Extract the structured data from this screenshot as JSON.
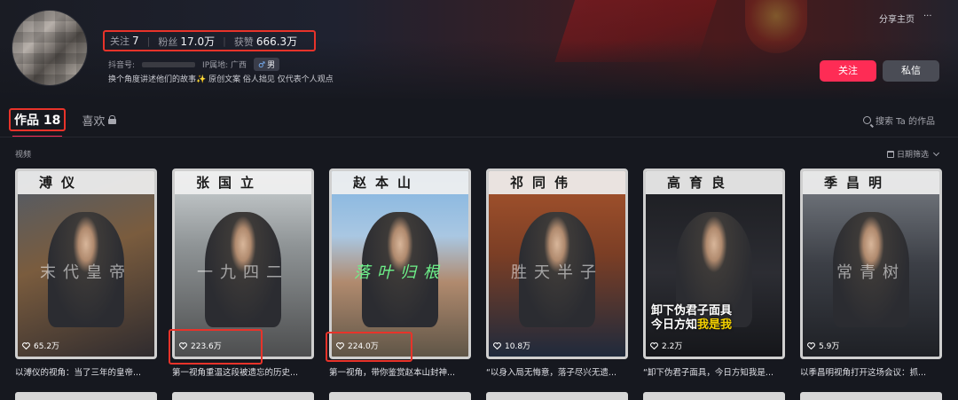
{
  "profile": {
    "username": "",
    "stats": {
      "following_label": "关注",
      "following_value": "7",
      "fans_label": "粉丝",
      "fans_value": "17.0万",
      "likes_label": "获赞",
      "likes_value": "666.3万"
    },
    "douyin_id_label": "抖音号:",
    "ip_label": "IP属地: 广西",
    "gender": "男",
    "bio": "换个角度讲述他们的故事✨ 原创文案 俗人拙见 仅代表个人观点"
  },
  "header_actions": {
    "share_label": "分享主页",
    "more_label": "···",
    "follow_label": "关注",
    "message_label": "私信"
  },
  "tabs": {
    "works_label": "作品 18",
    "likes_label": "喜欢"
  },
  "search": {
    "placeholder": "搜索 Ta 的作品"
  },
  "section": {
    "label": "视频",
    "sort_label": "日期筛选"
  },
  "videos": [
    {
      "name": "溥仪",
      "overlay": "末代皇帝",
      "likes": "65.2万",
      "title": "以溥仪的视角：当了三年的皇帝..."
    },
    {
      "name": "张国立",
      "overlay": "一九四二",
      "likes": "223.6万",
      "title": "第一视角重温这段被遗忘的历史..."
    },
    {
      "name": "赵本山",
      "overlay": "落叶归根",
      "likes": "224.0万",
      "title": "第一视角，带你鉴赏赵本山封神..."
    },
    {
      "name": "祁同伟",
      "overlay": "胜天半子",
      "likes": "10.8万",
      "title": "“以身入局无悔意，落子尽兴无遗..."
    },
    {
      "name": "高育良",
      "overlay": "",
      "caption_line1": "卸下伪君子面具",
      "caption_line2a": "今日方知",
      "caption_line2b": "我是我",
      "likes": "2.2万",
      "title": "“卸下伪君子面具，今日方知我是..."
    },
    {
      "name": "季昌明",
      "overlay": "常青树",
      "likes": "5.9万",
      "title": "以季昌明视角打开这场会议：抓..."
    }
  ],
  "colors": {
    "accent": "#fe2c55",
    "highlight_box": "#e8332a",
    "background": "#16181f"
  }
}
